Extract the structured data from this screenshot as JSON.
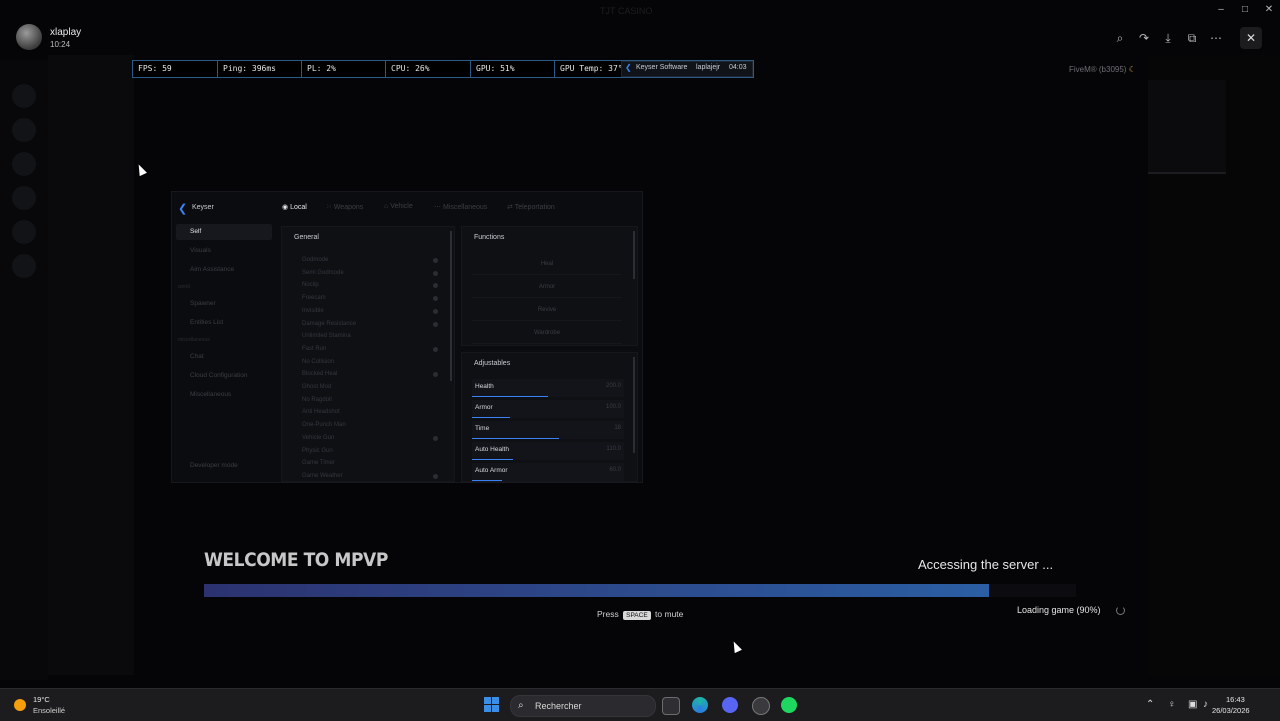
{
  "viewer": {
    "user_name": "xlaplay",
    "user_time": "10:24",
    "dim_title": "TJT CASINO",
    "actions": [
      "zoom-in-icon",
      "share-icon",
      "download-icon",
      "open-external-icon",
      "more-icon"
    ]
  },
  "perf": {
    "fps": "FPS: 59",
    "ping": "Ping: 396ms",
    "pl": "PL: 2%",
    "cpu": "CPU: 26%",
    "gpu": "GPU: 51%",
    "gpu_temp": "GPU Temp: 37°"
  },
  "keyser_badge": {
    "brand": "Keyser Software",
    "user": "laplajejr",
    "time": "04:03"
  },
  "fivem_label": "FiveM® (b3095)",
  "menu": {
    "logo": "Keyser",
    "tabs": [
      "Local",
      "Weapons",
      "Vehicle",
      "Miscellaneous",
      "Teleportation"
    ],
    "sidebar": {
      "items": [
        "Self",
        "Visuals",
        "Aim Assistance"
      ],
      "section2": "world",
      "items2": [
        "Spawner",
        "Entities List"
      ],
      "section3": "miscellaneous",
      "items3": [
        "Chat",
        "Cloud Configuration",
        "Miscellaneous"
      ],
      "footer": "Developer mode"
    },
    "general": {
      "title": "General",
      "options": [
        "Godmode",
        "Semi Godmode",
        "Noclip",
        "Freecam",
        "Invisible",
        "Damage Resistance",
        "Unlimited Stamina",
        "Fast Run",
        "No Collision",
        "Blocked Heal",
        "Ghost Mod",
        "No Ragdoll",
        "Anti Headshot",
        "One-Punch Man",
        "Vehicle Gun",
        "Physic Gun",
        "Game Timer",
        "Game Weather"
      ]
    },
    "functions": {
      "title": "Functions",
      "buttons": [
        "Heal",
        "Armor",
        "Revive",
        "Wardrobe"
      ]
    },
    "adjustables": {
      "title": "Adjustables",
      "rows": [
        {
          "label": "Health",
          "value": "200.0",
          "fill": 0.5
        },
        {
          "label": "Armor",
          "value": "100.0",
          "fill": 0.25
        },
        {
          "label": "Time",
          "value": "18",
          "fill": 0.57
        },
        {
          "label": "Auto Health",
          "value": "110.0",
          "fill": 0.27
        },
        {
          "label": "Auto Armor",
          "value": "60.0",
          "fill": 0.2
        }
      ]
    }
  },
  "loading": {
    "welcome": "WELCOME TO MPVP",
    "accessing": "Accessing the server ...",
    "progress": 0.9,
    "mute_prefix": "Press",
    "mute_key": "SPACE",
    "mute_suffix": "to mute",
    "status": "Loading game (90%)"
  },
  "taskbar": {
    "temp": "19°C",
    "weather": "Ensoleillé",
    "search_placeholder": "Rechercher",
    "time": "16:43",
    "date": "26/03/2026",
    "accent": "#3a8ee6"
  }
}
